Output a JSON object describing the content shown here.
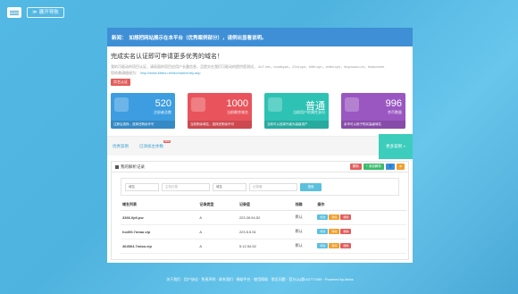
{
  "topbar": {
    "nav_label": "展开导航"
  },
  "news": {
    "label": "新闻：",
    "text": "如想把网站展示在本平台（优秀案例部分），请例出显看说明。"
  },
  "verify": {
    "title": "完成实名认证即可申请更多优秀的域名！",
    "desc": "我的可驱动的项目认证，请现面的项目应用户长重信息，且提交在我们可驱动的提供是测试，.3o7.net，localcyan，21st.cyn，bilbi.cyn，cbbsl.cyn，imyouuoo.cn，hostcomm",
    "link_prefix": "您的邀请链接为：",
    "link": "http://www.kfdns.net/domain/entry.asp",
    "badge": "实名认证"
  },
  "stats": [
    {
      "value": "520",
      "label": "注册者总数",
      "footer": "注册后选择，选择还剩余许可"
    },
    {
      "value": "1000",
      "label": "当前剩余域名",
      "footer": "当前剩余域名，选择还剩余许可"
    },
    {
      "value": "普通",
      "label": "当前用户的属性身份",
      "footer": "当前可以选择升级为高级用户"
    },
    {
      "value": "996",
      "label": "余币数量",
      "footer": "余币可以用于购买高级域名"
    }
  ],
  "tabs": {
    "items": [
      "优秀案例",
      "已添加主体数"
    ],
    "new_badge": "NEW",
    "more": "更多案例 »"
  },
  "panel": {
    "title": "我的解析记录",
    "buttons": [
      "删除",
      "+ 添加解析",
      "",
      ""
    ],
    "search": {
      "select1": "域名",
      "input1": "主机记录",
      "select2": "域名",
      "input2": "记录值",
      "button": "搜索"
    },
    "columns": [
      "域名列表",
      "记录类型",
      "记录值",
      "线路",
      "操作"
    ],
    "rows": [
      {
        "domain": "3366.0p0.pw",
        "type": "A",
        "value": "223.26.54.52",
        "line": "默认"
      },
      {
        "domain": "ho490.7miao.vip",
        "type": "A",
        "value": "223.5.5.51",
        "line": "默认"
      },
      {
        "domain": "464564.7miao.vip",
        "type": "A",
        "value": "5.12.54.52",
        "line": "默认"
      }
    ],
    "ops": [
      "修改",
      "暂停",
      "删除"
    ]
  },
  "footer": "关于我们 · 用户协议 · 免责声明 · 联系我们 · 捐助平台 · 使用帮助 · 常见问题 · 官方QQ群:62777089 · Powered by kfdns"
}
